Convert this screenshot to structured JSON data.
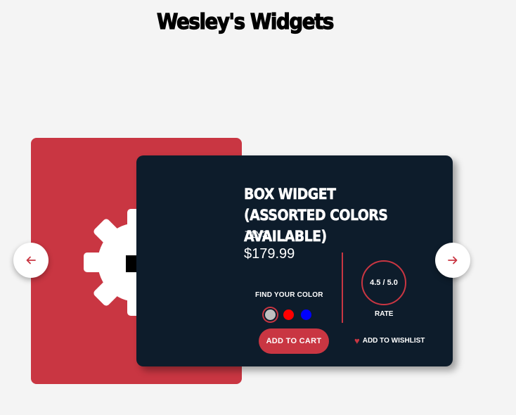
{
  "site": {
    "title": "Wesley's Widgets"
  },
  "product": {
    "name": "BOX WIDGET (ASSORTED COLORS AVAILABLE)",
    "sku": "71Y3",
    "price": "$179.99",
    "image_icon": "gear-icon",
    "color_label": "FIND YOUR COLOR",
    "colors": [
      {
        "name": "silver",
        "hex": "#c0c0c0",
        "selected": true
      },
      {
        "name": "red",
        "hex": "#ff0000",
        "selected": false
      },
      {
        "name": "blue",
        "hex": "#0000ff",
        "selected": false
      }
    ],
    "add_to_cart_label": "ADD TO CART",
    "rating": "4.5 / 5.0",
    "rating_label": "RATE",
    "wishlist_label": "ADD TO WISHLIST",
    "wishlist_icon": "heart-icon"
  },
  "nav": {
    "prev_icon": "arrow-left-icon",
    "next_icon": "arrow-right-icon"
  },
  "colors": {
    "accent": "#c93642",
    "card_dark": "#0d1c2b",
    "background": "#f4f4f4"
  }
}
